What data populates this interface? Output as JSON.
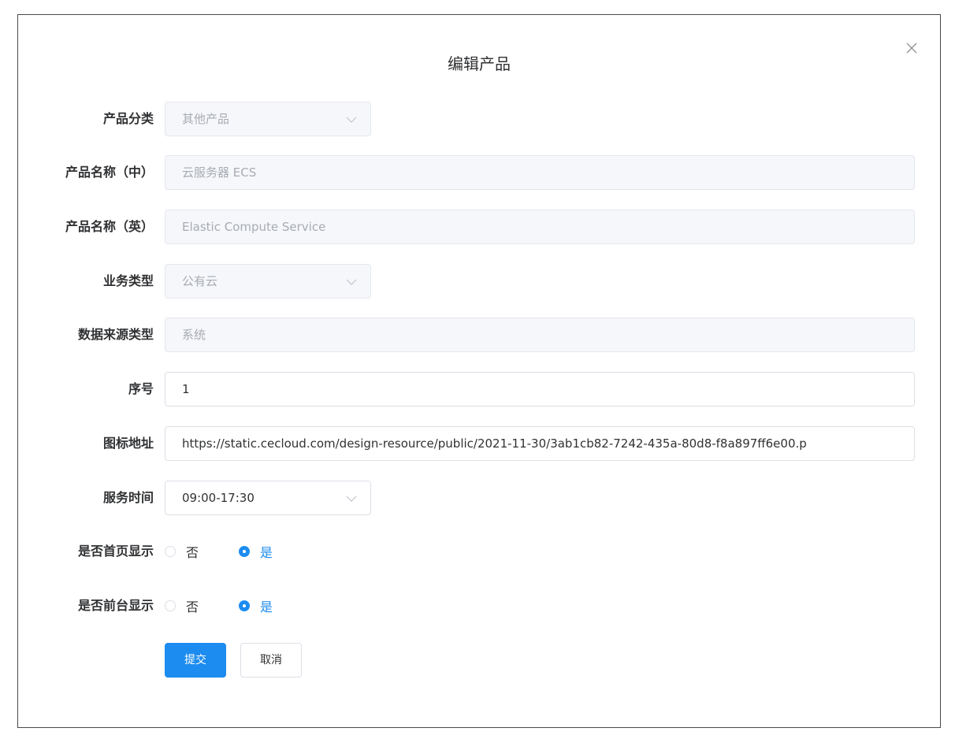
{
  "dialog": {
    "title": "编辑产品",
    "close_icon": "close-icon"
  },
  "form": {
    "category": {
      "label": "产品分类",
      "value": "其他产品"
    },
    "name_cn": {
      "label": "产品名称（中）",
      "value": "云服务器 ECS"
    },
    "name_en": {
      "label": "产品名称（英）",
      "value": "Elastic Compute Service"
    },
    "business_type": {
      "label": "业务类型",
      "value": "公有云"
    },
    "data_source": {
      "label": "数据来源类型",
      "value": "系统"
    },
    "order": {
      "label": "序号",
      "value": "1"
    },
    "icon_url": {
      "label": "图标地址",
      "value": "https://static.cecloud.com/design-resource/public/2021-11-30/3ab1cb82-7242-435a-80d8-f8a897ff6e00.p"
    },
    "service_time": {
      "label": "服务时间",
      "value": "09:00-17:30"
    },
    "show_homepage": {
      "label": "是否首页显示",
      "option_no": "否",
      "option_yes": "是",
      "selected": "是"
    },
    "show_frontend": {
      "label": "是否前台显示",
      "option_no": "否",
      "option_yes": "是",
      "selected": "是"
    }
  },
  "actions": {
    "submit_label": "提交",
    "cancel_label": "取消"
  },
  "colors": {
    "primary": "#1d8cf0",
    "disabled_bg": "#f5f7fa",
    "border": "#dcdfe6",
    "text": "#303133",
    "disabled_text": "#a8abb2"
  }
}
